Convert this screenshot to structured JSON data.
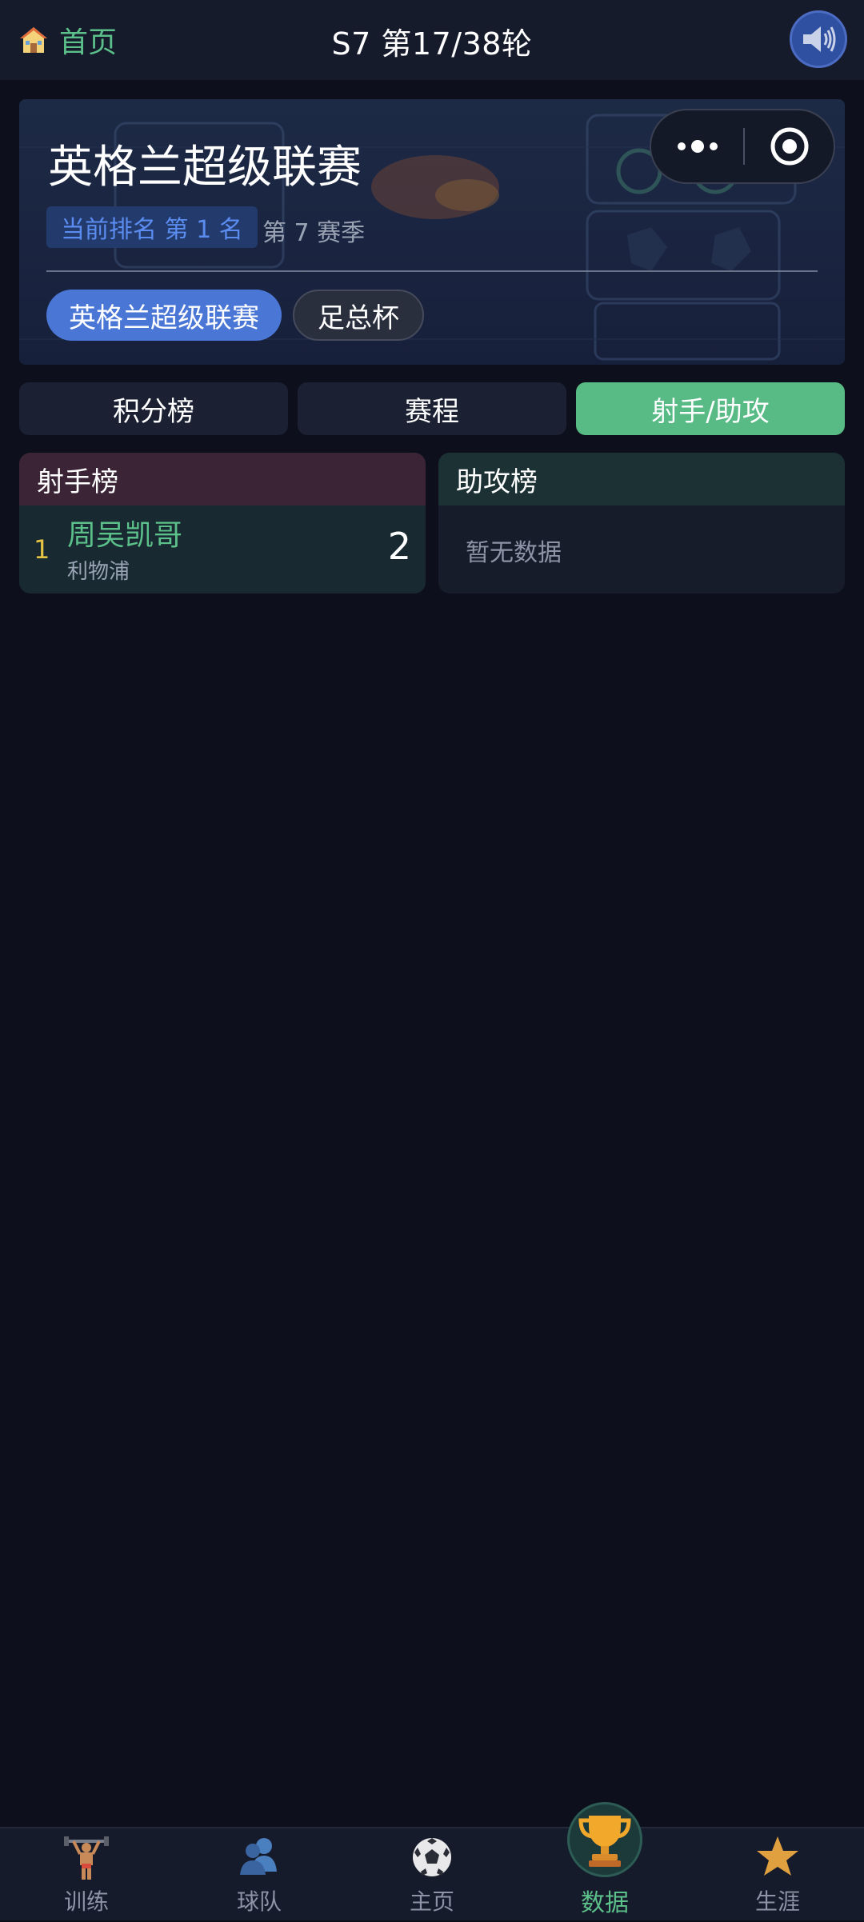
{
  "topbar": {
    "home_label": "首页",
    "round_title": "S7 第17/38轮"
  },
  "league": {
    "title": "英格兰超级联赛",
    "rank_badge": "当前排名 第 1 名",
    "season": "第 7 赛季",
    "competitions": [
      {
        "label": "英格兰超级联赛",
        "active": true
      },
      {
        "label": "足总杯",
        "active": false
      }
    ]
  },
  "tabs": [
    {
      "label": "积分榜",
      "active": false
    },
    {
      "label": "赛程",
      "active": false
    },
    {
      "label": "射手/助攻",
      "active": true
    }
  ],
  "scorers": {
    "title": "射手榜",
    "rows": [
      {
        "rank": "1",
        "name": "周吴凯哥",
        "team": "利物浦",
        "goals": "2"
      }
    ]
  },
  "assists": {
    "title": "助攻榜",
    "empty_text": "暂无数据"
  },
  "bottom_nav": [
    {
      "label": "训练",
      "icon": "weightlifter-icon",
      "active": false
    },
    {
      "label": "球队",
      "icon": "team-icon",
      "active": false
    },
    {
      "label": "主页",
      "icon": "soccer-ball-icon",
      "active": false
    },
    {
      "label": "数据",
      "icon": "trophy-icon",
      "active": true
    },
    {
      "label": "生涯",
      "icon": "star-icon",
      "active": false
    }
  ],
  "colors": {
    "background": "#0d101c",
    "accent_green": "#5cc08a",
    "accent_blue": "#4a76d6",
    "rank_gold": "#e6c443"
  }
}
